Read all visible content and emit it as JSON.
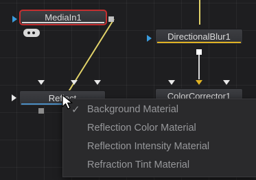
{
  "nodes": {
    "mediain": {
      "label": "MediaIn1"
    },
    "directional_blur": {
      "label": "DirectionalBlur1"
    },
    "reflect": {
      "label": "Reflect"
    },
    "color_corrector": {
      "label": "ColorCorrector1"
    }
  },
  "menu": {
    "items": [
      {
        "label": "Background Material",
        "checked": true
      },
      {
        "label": "Reflection Color Material",
        "checked": false
      },
      {
        "label": "Reflection Intensity Material",
        "checked": false
      },
      {
        "label": "Refraction Tint Material",
        "checked": false
      }
    ],
    "check_glyph": "✓"
  },
  "colors": {
    "selected_border": "#c42f30",
    "selected_bar": "#d8d8d8",
    "normal_bar": "#4a8ec4",
    "blur_bar": "#e0b324",
    "wire_yellow": "#e2d36a",
    "input_arrow": "#3a9bdc"
  },
  "icons": [
    "input-arrow-icon",
    "output-square-icon",
    "view-toggle-icon",
    "pointer-cursor-icon",
    "checkmark-icon"
  ]
}
